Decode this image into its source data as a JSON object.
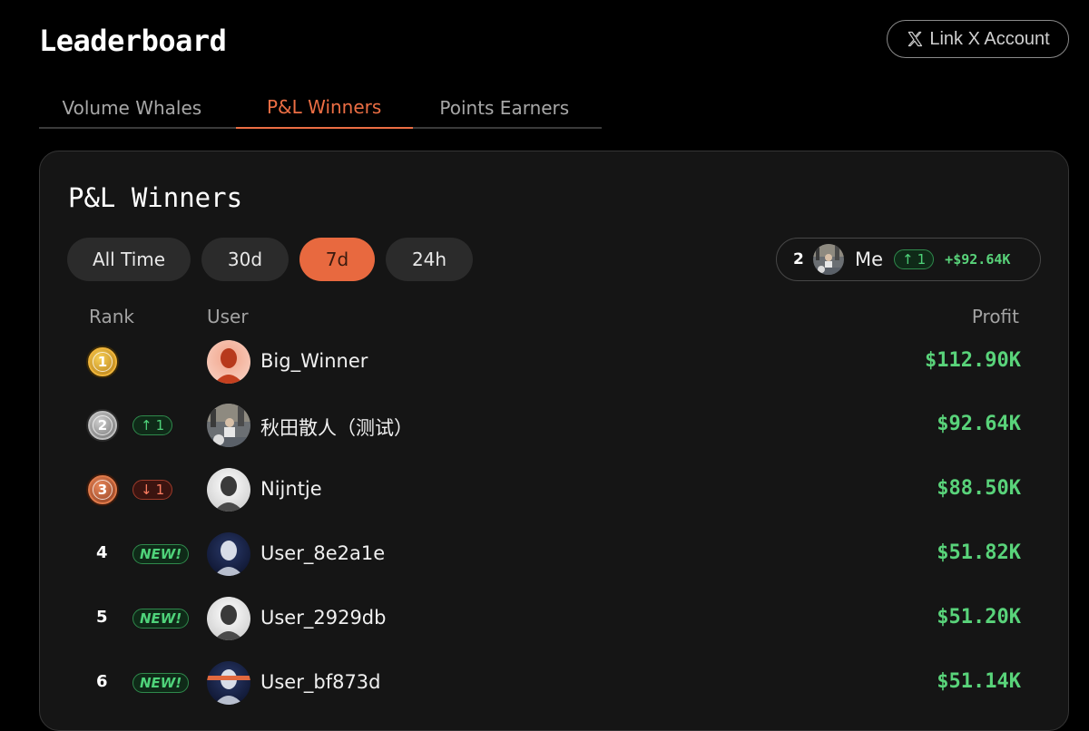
{
  "header": {
    "title": "Leaderboard",
    "link_x_label": "Link X Account"
  },
  "tabs": [
    {
      "label": "Volume Whales",
      "active": false
    },
    {
      "label": "P&L Winners",
      "active": true
    },
    {
      "label": "Points Earners",
      "active": false
    }
  ],
  "card": {
    "title": "P&L Winners",
    "filters": [
      {
        "label": "All Time",
        "active": false
      },
      {
        "label": "30d",
        "active": false
      },
      {
        "label": "7d",
        "active": true
      },
      {
        "label": "24h",
        "active": false
      }
    ],
    "me": {
      "rank": "2",
      "name": "Me",
      "change": "1",
      "change_dir": "up",
      "profit": "+$92.64K"
    },
    "columns": {
      "rank": "Rank",
      "user": "User",
      "profit": "Profit"
    },
    "rows": [
      {
        "rank": "1",
        "medal": "gold",
        "change": "",
        "change_dir": "",
        "user": "Big_Winner",
        "profit": "$112.90K"
      },
      {
        "rank": "2",
        "medal": "silver",
        "change": "1",
        "change_dir": "up",
        "user": "秋田散人（测试）",
        "profit": "$92.64K"
      },
      {
        "rank": "3",
        "medal": "bronze",
        "change": "1",
        "change_dir": "down",
        "user": "Nijntje",
        "profit": "$88.50K"
      },
      {
        "rank": "4",
        "medal": "",
        "change": "NEW!",
        "change_dir": "new",
        "user": "User_8e2a1e",
        "profit": "$51.82K"
      },
      {
        "rank": "5",
        "medal": "",
        "change": "NEW!",
        "change_dir": "new",
        "user": "User_2929db",
        "profit": "$51.20K"
      },
      {
        "rank": "6",
        "medal": "",
        "change": "NEW!",
        "change_dir": "new",
        "user": "User_bf873d",
        "profit": "$51.14K"
      }
    ]
  },
  "colors": {
    "accent": "#e8693f",
    "profit_green": "#59d37a",
    "background": "#000000",
    "card": "#151515"
  }
}
